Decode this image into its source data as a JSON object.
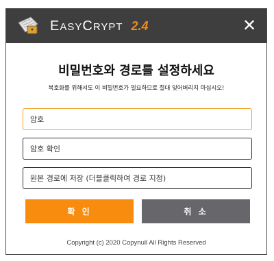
{
  "titlebar": {
    "brand_first": "E",
    "brand_rest": "ASY",
    "brand_first2": "C",
    "brand_rest2": "RYPT",
    "version": "2.4",
    "close_glyph": "✕",
    "logo_icon": "lock-certificate-icon"
  },
  "dialog": {
    "heading": "비밀번호와 경로를 설정하세요",
    "subtext": "복호화를 위해서도 이 비밀번호가 필요하므로 절대 잊어버리지 마십시오!",
    "password_placeholder": "암호",
    "password_confirm_placeholder": "암호 확인",
    "path_placeholder": "원본 경로에 저장 (더블클릭하여 경로 지정)",
    "ok_label": "확 인",
    "cancel_label": "취 소",
    "footer": "Copyright (c) 2020 Copynull All Rights Reserved"
  },
  "colors": {
    "titlebar": "#3e3e3e",
    "accent": "#f88c0e",
    "cancel": "#66666b",
    "active_border": "#f0a020"
  }
}
